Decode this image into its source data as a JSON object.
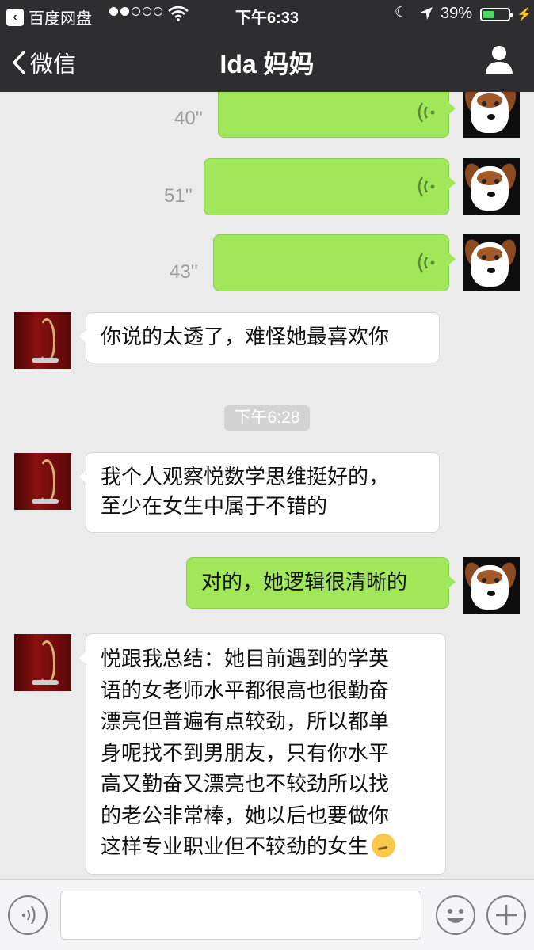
{
  "status_bar": {
    "carrier": "百度网盘",
    "time": "下午6:33",
    "battery_percent_text": "39%",
    "battery_level": 0.39
  },
  "nav": {
    "back_label": "微信",
    "title": "Ida 妈妈"
  },
  "messages": [
    {
      "side": "right",
      "type": "voice",
      "duration": "40''"
    },
    {
      "side": "right",
      "type": "voice",
      "duration": "51''"
    },
    {
      "side": "right",
      "type": "voice",
      "duration": "43''"
    },
    {
      "side": "left",
      "type": "text",
      "text": "你说的太透了，难怪她最喜欢你"
    },
    {
      "type": "timestamp",
      "text": "下午6:28"
    },
    {
      "side": "left",
      "type": "text",
      "text": "我个人观察悦数学思维挺好的，\n至少在女生中属于不错的"
    },
    {
      "side": "right",
      "type": "text",
      "text": "对的，她逻辑很清晰的"
    },
    {
      "side": "left",
      "type": "text",
      "text": "悦跟我总结：她目前遇到的学英\n语的女老师水平都很高也很勤奋\n漂亮但普遍有点较劲，所以都单\n身呢找不到男朋友，只有你水平\n高又勤奋又漂亮也不较劲所以找\n的老公非常棒，她以后也要做你\n这样专业职业但不较劲的女生",
      "emoji": "thinking-face"
    }
  ],
  "colors": {
    "nav_bg": "#2e2e30",
    "chat_bg": "#ebebeb",
    "sent_bubble": "#a0e75a",
    "received_bubble": "#ffffff",
    "battery": "#4cd964"
  }
}
